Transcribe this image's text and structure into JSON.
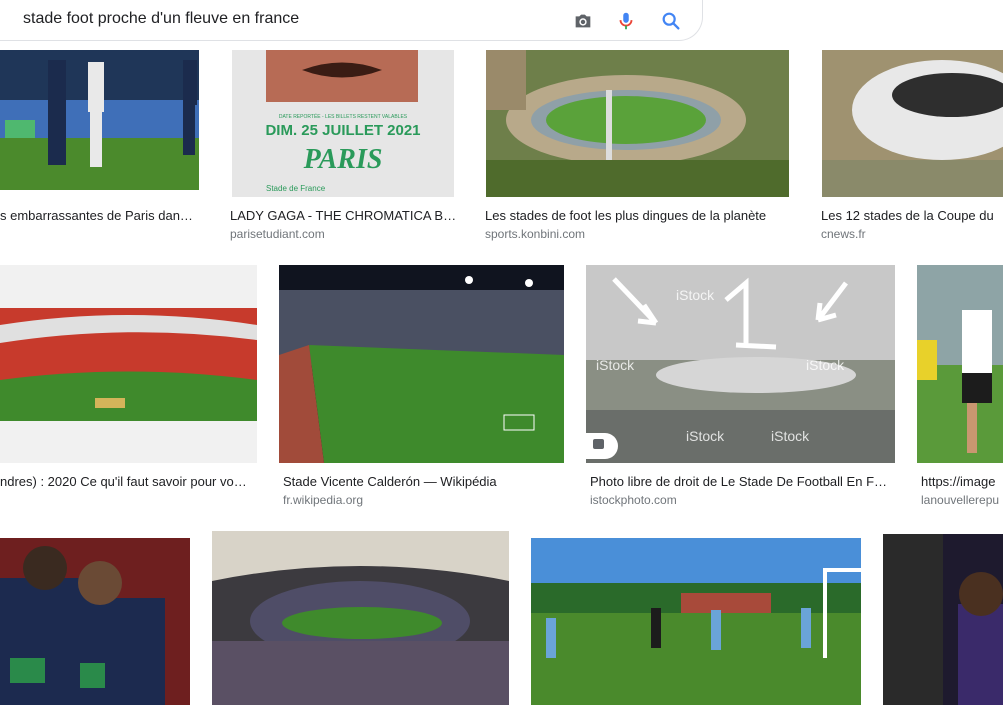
{
  "search": {
    "query": "stade foot proche d'un fleuve en france"
  },
  "icons": {
    "camera": "camera-icon",
    "mic": "microphone-icon",
    "search": "magnifier-icon"
  },
  "colors": {
    "mic_red": "#ea4335",
    "mic_blue": "#4285f4",
    "search_blue": "#4285f4",
    "source_gray": "#70757a"
  },
  "results": {
    "row1": [
      {
        "caption": "s embarrassantes de Paris dan…",
        "source": ""
      },
      {
        "caption": "LADY GAGA - THE CHROMATICA B…",
        "source": "parisetudiant.com"
      },
      {
        "caption": "Les stades de foot les plus dingues de la planète",
        "source": "sports.konbini.com"
      },
      {
        "caption": "Les 12 stades de la Coupe du",
        "source": "cnews.fr"
      }
    ],
    "row2": [
      {
        "caption": "ndres) : 2020 Ce qu'il faut savoir pour vo…",
        "source": ""
      },
      {
        "caption": "Stade Vicente Calderón — Wikipédia",
        "source": "fr.wikipedia.org"
      },
      {
        "caption": "Photo libre de droit de Le Stade De Football En F…",
        "source": "istockphoto.com"
      },
      {
        "caption": "https://image",
        "source": "lanouvellerepu"
      }
    ]
  },
  "poster": {
    "line1": "DATE REPORTÉE - LES BILLETS RESTENT VALABLES",
    "line2": "DIM. 25 JUILLET 2021",
    "line3": "PARIS",
    "line4": "Stade de France"
  },
  "istock": {
    "watermark": "iStock"
  }
}
